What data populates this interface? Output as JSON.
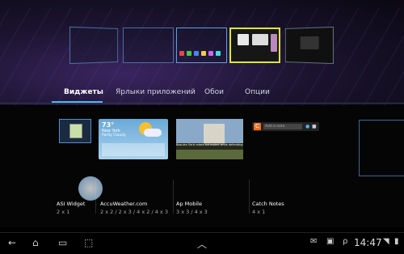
{
  "tabs": [
    {
      "label": "Виджеты"
    },
    {
      "label": "Ярлыки приложений"
    },
    {
      "label": "Обои"
    },
    {
      "label": "Опции"
    }
  ],
  "widgets": [
    {
      "name": "ASI Widget",
      "size": "2 x 1"
    },
    {
      "name": "AccuWeather.com",
      "size": "2 x 2 / 2 x 3 / 4 x 2 / 4 x 3"
    },
    {
      "name": "Ap Mobile",
      "size": "3 x 3 / 4 x 3"
    },
    {
      "name": "Catch Notes",
      "size": "4 x 1"
    }
  ],
  "weather_preview": {
    "temp": "73°",
    "city": "New York",
    "condition": "Partly Cloudy"
  },
  "news_preview": {
    "headline": "Bosnian Serb rebels beheaded while defending..."
  },
  "catch_preview": {
    "placeholder": "Add a note"
  },
  "status_bar": {
    "time": "14:47"
  },
  "colors": {
    "accent": "#4fb3f0",
    "active_screen_border": "#dde830"
  }
}
